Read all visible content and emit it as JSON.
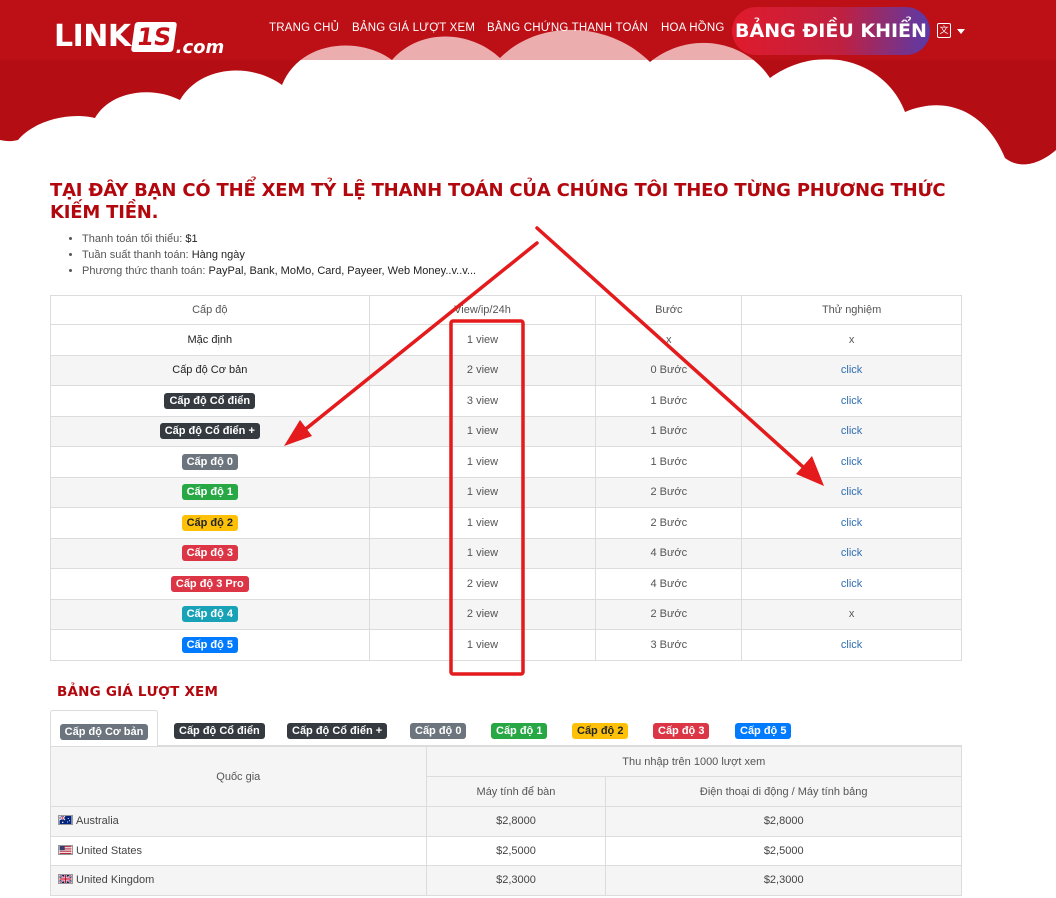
{
  "brand": {
    "logo_link": "LINK",
    "logo_is": "1S",
    "logo_com": ".com",
    "primary_color": "#c40f17",
    "title_color": "#b3070e"
  },
  "nav": {
    "home": "TRANG CHỦ",
    "view_rates": "BẢNG GIÁ LƯỢT XEM",
    "payment_proof": "BẰNG CHỨNG THANH TOÁN",
    "commission": "HOA HỒNG",
    "dashboard": "BẢNG ĐIỀU KHIỂN",
    "language_icon": "translate-icon"
  },
  "intro": {
    "title": "TẠI ĐÂY BẠN CÓ THỂ XEM TỶ LỆ THANH TOÁN CỦA CHÚNG TÔI THEO TỪNG PHƯƠNG THỨC KIẾM TIỀN.",
    "items": [
      {
        "label": "Thanh toán tối thiểu: ",
        "value": "$1"
      },
      {
        "label": "Tuần suất thanh toán: ",
        "value": "Hàng ngày"
      },
      {
        "label": "Phương thức thanh toán: ",
        "value": "PayPal, Bank, MoMo, Card, Payeer, Web Money..v..v..."
      }
    ]
  },
  "level_table": {
    "headers": [
      "Cấp độ",
      "View/ip/24h",
      "Bước",
      "Thử nghiệm"
    ],
    "rows": [
      {
        "level": "Mặc định",
        "badge": "none",
        "views": "1 view",
        "steps": "x",
        "trial": "x",
        "trial_link": false
      },
      {
        "level": "Cấp độ Cơ bản",
        "badge": "none",
        "views": "2 view",
        "steps": "0 Bước",
        "trial": "click",
        "trial_link": true
      },
      {
        "level": "Cấp độ Cổ điển",
        "badge": "b-dark",
        "views": "3 view",
        "steps": "1 Bước",
        "trial": "click",
        "trial_link": true
      },
      {
        "level": "Cấp độ Cổ điển +",
        "badge": "b-dark",
        "views": "1 view",
        "steps": "1 Bước",
        "trial": "click",
        "trial_link": true
      },
      {
        "level": "Cấp độ 0",
        "badge": "b-gray",
        "views": "1 view",
        "steps": "1 Bước",
        "trial": "click",
        "trial_link": true
      },
      {
        "level": "Cấp độ 1",
        "badge": "b-green",
        "views": "1 view",
        "steps": "2 Bước",
        "trial": "click",
        "trial_link": true
      },
      {
        "level": "Cấp độ 2",
        "badge": "b-yellow",
        "views": "1 view",
        "steps": "2 Bước",
        "trial": "click",
        "trial_link": true
      },
      {
        "level": "Cấp độ 3",
        "badge": "b-red",
        "views": "1 view",
        "steps": "4 Bước",
        "trial": "click",
        "trial_link": true
      },
      {
        "level": "Cấp độ 3 Pro",
        "badge": "b-red",
        "views": "2 view",
        "steps": "4 Bước",
        "trial": "click",
        "trial_link": true
      },
      {
        "level": "Cấp độ 4",
        "badge": "b-teal",
        "views": "2 view",
        "steps": "2 Bước",
        "trial": "x",
        "trial_link": false
      },
      {
        "level": "Cấp độ 5",
        "badge": "b-blue",
        "views": "1 view",
        "steps": "3 Bước",
        "trial": "click",
        "trial_link": true
      }
    ]
  },
  "annotations": {
    "color": "#e41a1c"
  },
  "pricing": {
    "title": "BẢNG GIÁ LƯỢT XEM",
    "tabs": [
      {
        "label": "Cấp độ Cơ bản",
        "badge": "b-gray",
        "active": true
      },
      {
        "label": "Cấp độ Cổ điển",
        "badge": "b-dark",
        "active": false
      },
      {
        "label": "Cấp độ Cổ điển +",
        "badge": "b-dark",
        "active": false
      },
      {
        "label": "Cấp độ 0",
        "badge": "b-gray",
        "active": false
      },
      {
        "label": "Cấp độ 1",
        "badge": "b-green",
        "active": false
      },
      {
        "label": "Cấp độ 2",
        "badge": "b-yellow",
        "active": false
      },
      {
        "label": "Cấp độ 3",
        "badge": "b-red",
        "active": false
      },
      {
        "label": "Cấp độ 5",
        "badge": "b-blue",
        "active": false
      }
    ],
    "country_header": "Quốc gia",
    "income_header": "Thu nhập trên 1000 lượt xem",
    "desktop_header": "Máy tính để bàn",
    "mobile_header": "Điện thoại di động / Máy tính bảng",
    "rows": [
      {
        "country": "Australia",
        "flag": "au-flag-icon",
        "desktop": "$2,8000",
        "mobile": "$2,8000"
      },
      {
        "country": "United States",
        "flag": "us-flag-icon",
        "desktop": "$2,5000",
        "mobile": "$2,5000"
      },
      {
        "country": "United Kingdom",
        "flag": "uk-flag-icon",
        "desktop": "$2,3000",
        "mobile": "$2,3000"
      }
    ]
  }
}
